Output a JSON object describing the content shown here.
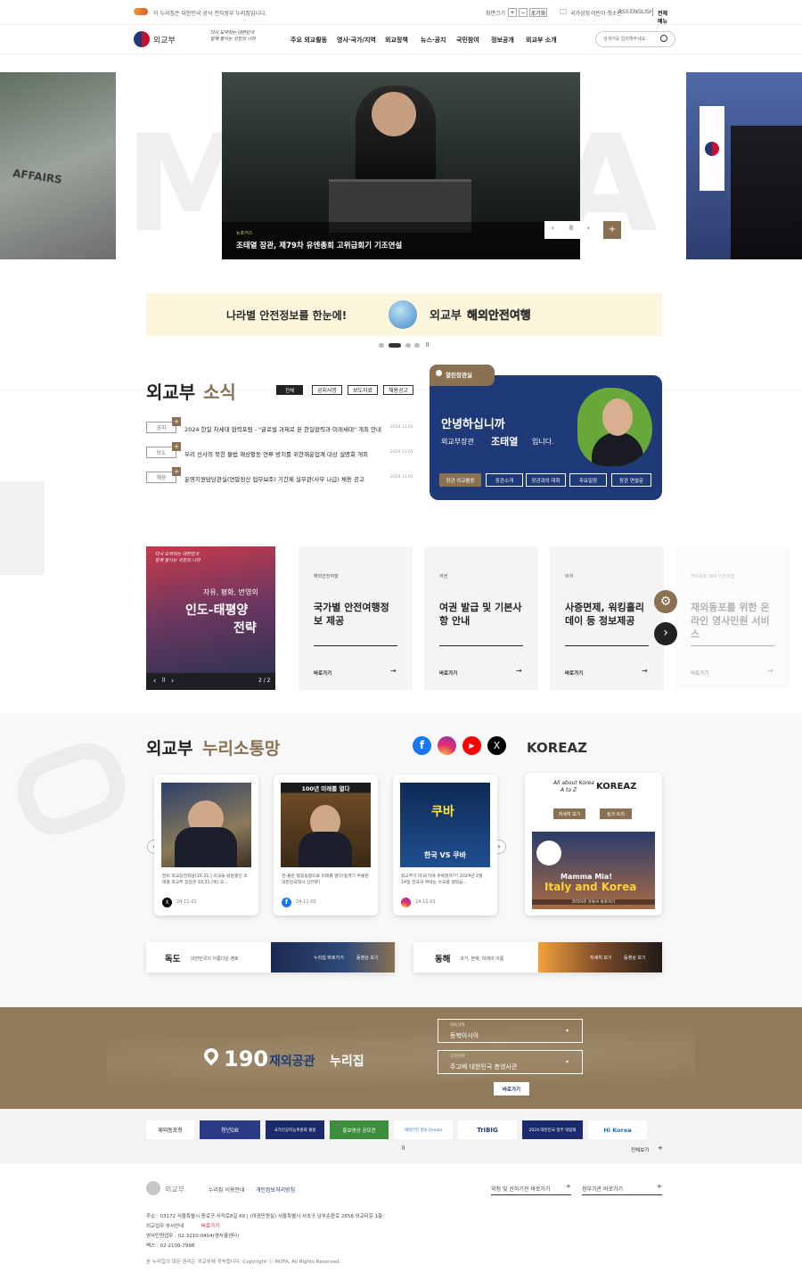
{
  "topbar": {
    "notice": "이 누리집은 대한민국 공식 전자정부 누리집입니다.",
    "zoom_label": "화면크기",
    "zoom_in": "+",
    "zoom_out": "−",
    "zoom_reset": "초기화",
    "links": [
      "국가상징",
      "어린이·청소년",
      "RSS",
      "ENGLISH"
    ],
    "all_menu": "전체 메뉴"
  },
  "header": {
    "logo": "외교부",
    "slogan": "다시 도약하는 대한민국\n함께 잘사는 국민의 나라",
    "gnb": [
      "주요 외교활동",
      "영사·국가/지역",
      "외교정책",
      "뉴스·공지",
      "국민참여",
      "정보공개",
      "외교부 소개"
    ],
    "search_placeholder": "검색어를 입력해주세요."
  },
  "hero": {
    "bg_text": "MOFA",
    "tag": "뉴포커스",
    "title": "조태열 장관, 제79차 유엔총회 고위급회기 기조연설",
    "side_left_text": "AFFAIRS"
  },
  "banner": {
    "left": "나라별 안전정보를 한눈에!",
    "right_a": "외교부",
    "right_b": "해외안전여행"
  },
  "news": {
    "title_a": "외교부",
    "title_b": "소식",
    "tabs": [
      "전체",
      "공지사항",
      "보도자료",
      "채용공고"
    ],
    "items": [
      {
        "tag": "공지",
        "text": "2024 한일 차세대 협력포럼 - \"글로벌 과제로 본 한일협력과 미래세대\" 개최 안내",
        "date": "2024.11.01"
      },
      {
        "tag": "보도",
        "text": "우리 선사의 북한 불법 해상활동 연루 방지를 위한해운업계 대상 설명회 개최",
        "date": "2024.11.01"
      },
      {
        "tag": "채용",
        "text": "운영지원담당관실(연말정산 업무보조) 기간제 실무관(사무 나급) 채용 공고",
        "date": "2024.11.01"
      }
    ]
  },
  "minister": {
    "badge": "열린장관실",
    "hello": "안녕하십니까",
    "line_a": "외교부장관",
    "line_name": "조태열",
    "line_b": "입니다.",
    "buttons": [
      "장관 외교활동",
      "장관소개",
      "장관과의 대화",
      "주요일정",
      "장관 연설문"
    ]
  },
  "strategy": {
    "slogan": "다시 도약하는 대한민국\n함께 잘사는 국민의 나라",
    "line1": "자유, 평화, 번영의",
    "line2": "인도-태평양",
    "line3": "전략",
    "page": "2 / 2"
  },
  "cards": [
    {
      "cat": "해외안전여행",
      "title": "국가별 안전여행정보 제공",
      "link": "바로가기"
    },
    {
      "cat": "여권",
      "title": "여권 발급 및 기본사항 안내",
      "link": "바로가기"
    },
    {
      "cat": "비자",
      "title": "사증면제, 워킹홀리데이 등 정보제공",
      "link": "바로가기"
    },
    {
      "cat": "재외동포 365 민원포털",
      "title": "재외동포를 위한 온라인 영사민원 서비스",
      "link": "바로가기"
    }
  ],
  "sns": {
    "title_a": "외교부",
    "title_b": "누리소통망",
    "koreaz": "KOREAZ",
    "posts": [
      {
        "img_caption": "",
        "text": "한미 외교장관회담(10.31.) 미국을 방문중인 조태열 외교부 장관은 10.31.(목) 오...",
        "date": "24-11-01",
        "net": "X"
      },
      {
        "img_caption": "100년 미래를 열다",
        "text": "한-폴란 협정동향으로 미래를 열다(동영기 주폴란대한민국대사 인터뷰)",
        "date": "24-11-03",
        "net": "f"
      },
      {
        "img_caption": "한국 VS 쿠바",
        "text": "외교부가 마국(?)에 주목할까?!! 2024년 2월 14일 한국과 쿠바는 수교를 맺었습...",
        "date": "24-11-01",
        "net": "ig"
      }
    ],
    "koreaz_card": {
      "title_a": "All about Korea",
      "title_b": "A to Z",
      "logo": "KOREAZ",
      "btn1": "자세히 보기",
      "btn2": "링크 트리",
      "big1": "Mamma Mia!",
      "big2": "Italy and Korea",
      "sub": "코리아즈 유튜브 바로가기"
    }
  },
  "dokdo": {
    "name": "독도",
    "desc": "대한민국의 아름다운 영토",
    "b1": "누리집 바로가기",
    "b2": "동영상 보기"
  },
  "donghae": {
    "name": "동해",
    "desc": "과거, 현재, 미래의 이름",
    "b1": "자세히 보기",
    "b2": "동영상 보기"
  },
  "missions": {
    "count": "190",
    "label_a": "재외공관",
    "label_b": "누리집",
    "region_label": "대륙선택",
    "region": "동북아시아",
    "office_label": "공관선택",
    "office": "주고베 대한민국 총영사관",
    "go": "바로가기"
  },
  "related": {
    "items": [
      "재외동포청",
      "청년DB",
      "국가인공지능위원회 출범",
      "홍보영상 공모전",
      "해외안전 정보 Dream",
      "TriBIG",
      "2024 대한민국 정부 박람회",
      "Hi Korea"
    ],
    "all": "전체보기"
  },
  "footer": {
    "logo": "외교부",
    "link1": "누리집 이용안내",
    "link2": "개인정보처리방침",
    "sel1": "외청 및 산하기관 바로가기",
    "sel2": "정부기관 바로가기",
    "addr": "주소 : 03172 서울특별시 종로구 사직로8길 60 | (여권민원실) 서울특별시 서초구 남부순환로 2558 외교타운 1층",
    "info": "외교업무 부서안내",
    "info_link": "바로가기",
    "phone": "영사민원업무 : 02-3210-0404(영사콜센터)",
    "fax": "팩스 : 02-2100-7998",
    "copy": "본 누리집의 모든 권리는 외교부에 귀속됩니다. Copyright ⓒ MOFA. All Rights Reserved."
  },
  "colors": {
    "navy": "#1f3a78",
    "gold": "#8a7152",
    "brown_band": "#8f7a5a"
  }
}
